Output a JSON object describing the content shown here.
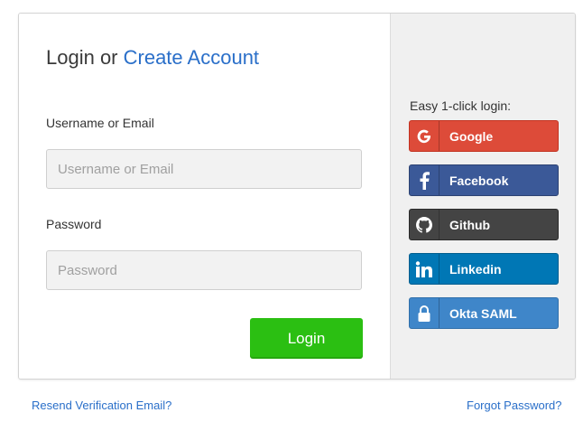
{
  "header": {
    "title_prefix": "Login or ",
    "title_link": "Create Account"
  },
  "form": {
    "username_label": "Username or Email",
    "username_placeholder": "Username or Email",
    "username_value": "",
    "password_label": "Password",
    "password_placeholder": "Password",
    "password_value": "",
    "submit_label": "Login"
  },
  "sso": {
    "heading": "Easy 1-click login:",
    "providers": [
      {
        "label": "Google",
        "icon": "google-icon",
        "color": "#dd4b39"
      },
      {
        "label": "Facebook",
        "icon": "facebook-icon",
        "color": "#3b5998"
      },
      {
        "label": "Github",
        "icon": "github-icon",
        "color": "#444444"
      },
      {
        "label": "Linkedin",
        "icon": "linkedin-icon",
        "color": "#0077b5"
      },
      {
        "label": "Okta SAML",
        "icon": "lock-icon",
        "color": "#3f86c9"
      }
    ]
  },
  "footer": {
    "resend_label": "Resend Verification Email?",
    "forgot_label": "Forgot Password?"
  },
  "colors": {
    "accent": "#2a6fc9",
    "login_button": "#2bbf12"
  }
}
